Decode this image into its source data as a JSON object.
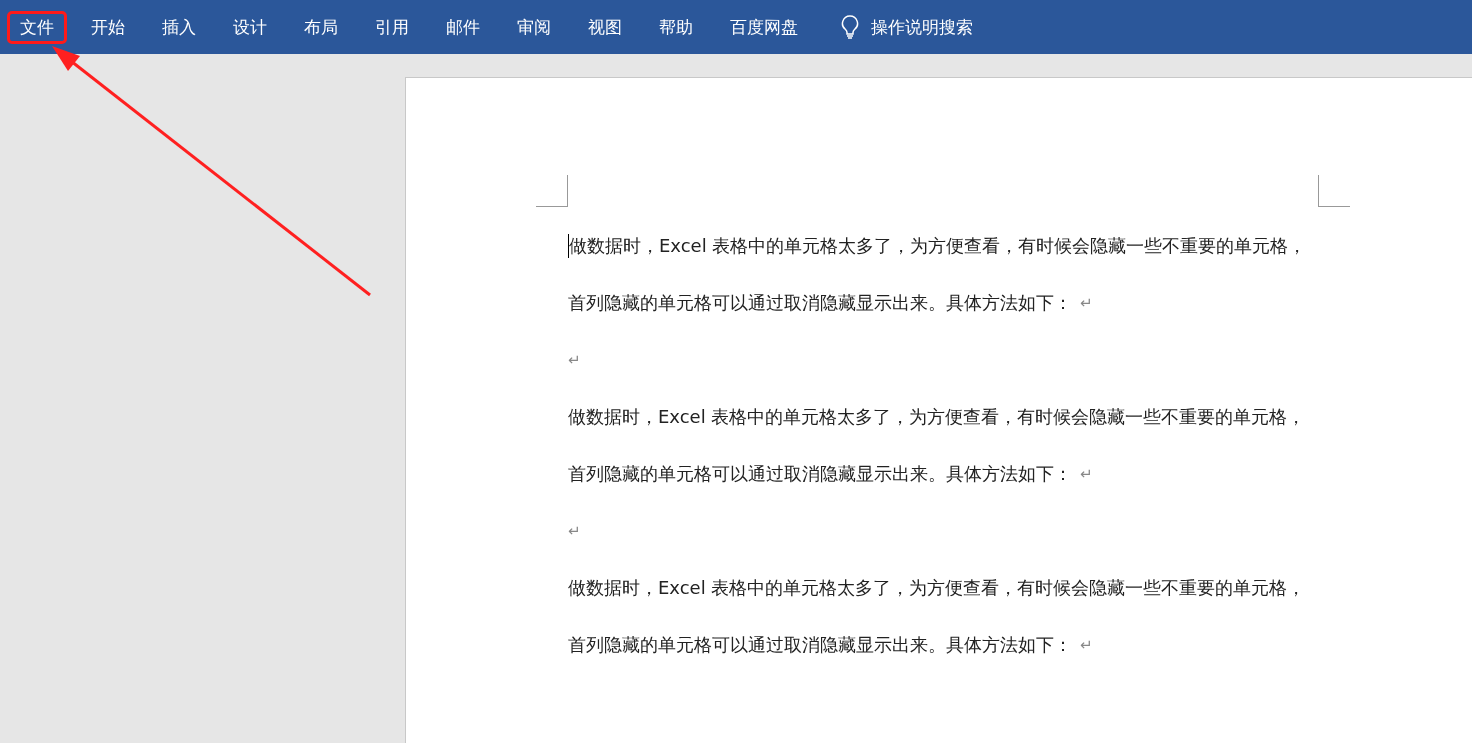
{
  "ribbon": {
    "tabs": [
      {
        "label": "文件",
        "highlighted": true
      },
      {
        "label": "开始",
        "highlighted": false
      },
      {
        "label": "插入",
        "highlighted": false
      },
      {
        "label": "设计",
        "highlighted": false
      },
      {
        "label": "布局",
        "highlighted": false
      },
      {
        "label": "引用",
        "highlighted": false
      },
      {
        "label": "邮件",
        "highlighted": false
      },
      {
        "label": "审阅",
        "highlighted": false
      },
      {
        "label": "视图",
        "highlighted": false
      },
      {
        "label": "帮助",
        "highlighted": false
      },
      {
        "label": "百度网盘",
        "highlighted": false
      }
    ],
    "search": {
      "label": "操作说明搜索"
    }
  },
  "document": {
    "paragraphs": [
      {
        "kind": "text",
        "lines": [
          "做数据时，Excel 表格中的单元格太多了，为方便查看，有时候会隐藏一些不重要的单元格，",
          "首列隐藏的单元格可以通过取消隐藏显示出来。具体方法如下："
        ],
        "return_mark": "↵"
      },
      {
        "kind": "empty",
        "return_mark": "↵"
      },
      {
        "kind": "text",
        "lines": [
          "做数据时，Excel 表格中的单元格太多了，为方便查看，有时候会隐藏一些不重要的单元格，",
          "首列隐藏的单元格可以通过取消隐藏显示出来。具体方法如下："
        ],
        "return_mark": "↵"
      },
      {
        "kind": "empty",
        "return_mark": "↵"
      },
      {
        "kind": "text",
        "lines": [
          "做数据时，Excel 表格中的单元格太多了，为方便查看，有时候会隐藏一些不重要的单元格，",
          "首列隐藏的单元格可以通过取消隐藏显示出来。具体方法如下："
        ],
        "return_mark": "↵"
      }
    ]
  }
}
